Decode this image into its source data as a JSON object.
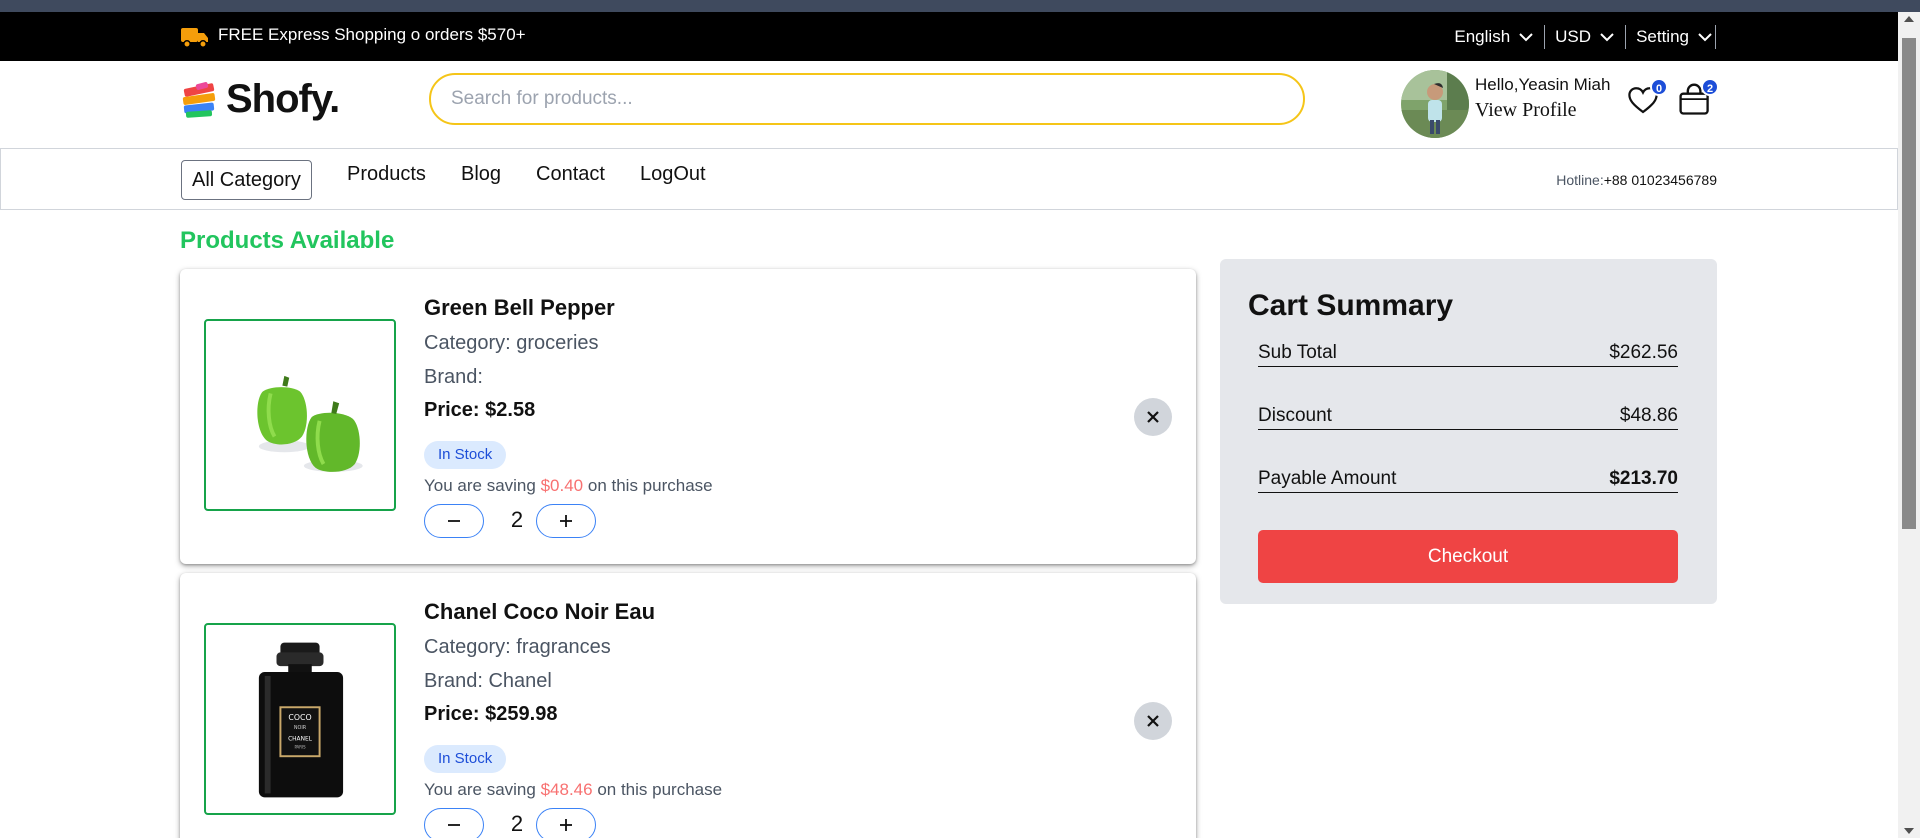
{
  "announcement": {
    "promo": "FREE Express Shopping o orders $570+",
    "language": "English",
    "currency": "USD",
    "setting": "Setting"
  },
  "header": {
    "logo_text": "Shofy.",
    "search_placeholder": "Search for products...",
    "greeting": "Hello,Yeasin Miah",
    "view_profile": "View Profile",
    "wishlist_count": "0",
    "cart_count": "2"
  },
  "nav": {
    "category": "All Category",
    "links": [
      "Products",
      "Blog",
      "Contact",
      "LogOut"
    ],
    "hotline_label": "Hotline:",
    "hotline_number": "+88 01023456789"
  },
  "main": {
    "title": "Products Available",
    "items": [
      {
        "name": "Green Bell Pepper",
        "category": "Category: groceries",
        "brand": "Brand: ",
        "price_label": "Price:",
        "price": "$2.58",
        "stock": "In Stock",
        "saving_prefix": "You are saving",
        "saving_amount": "$0.40",
        "saving_suffix": "on this purchase",
        "quantity": "2",
        "image": "green-bell-pepper"
      },
      {
        "name": "Chanel Coco Noir Eau",
        "category": "Category: fragrances",
        "brand": "Brand: Chanel",
        "price_label": "Price:",
        "price": "$259.98",
        "stock": "In Stock",
        "saving_prefix": "You are saving",
        "saving_amount": "$48.46",
        "saving_suffix": "on this purchase",
        "quantity": "2",
        "image": "chanel-perfume-bottle",
        "bottle_label_top": "COCO",
        "bottle_label_mid": "NOIR",
        "bottle_label_brand": "CHANEL",
        "bottle_label_small": "PARIS"
      }
    ]
  },
  "summary": {
    "title": "Cart Summary",
    "subtotal_label": "Sub Total",
    "subtotal": "$262.56",
    "discount_label": "Discount",
    "discount": "$48.86",
    "payable_label": "Payable Amount",
    "payable": "$213.70",
    "checkout": "Checkout"
  },
  "colors": {
    "accent_green": "#22c55e",
    "checkout_red": "#ef4444",
    "search_border": "#f5c518",
    "saving_red": "#f87171",
    "badge_blue": "#1d4ed8"
  }
}
